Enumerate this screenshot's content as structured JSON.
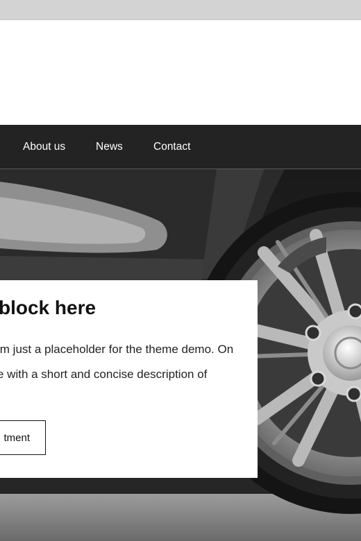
{
  "nav": {
    "items": [
      {
        "label": "About us"
      },
      {
        "label": "News"
      },
      {
        "label": "Contact"
      }
    ]
  },
  "hero": {
    "image": "black-car-wheel-photo",
    "card": {
      "title": "block here",
      "text_line1": "’m just a placeholder for the theme demo. On",
      "text_line2": "e with a short and concise description of",
      "button_label": "tment"
    }
  },
  "colors": {
    "top_strip": "#d3d3d3",
    "navbar": "#232323",
    "nav_text": "#ffffff",
    "card_bg": "#ffffff",
    "text": "#111111"
  }
}
